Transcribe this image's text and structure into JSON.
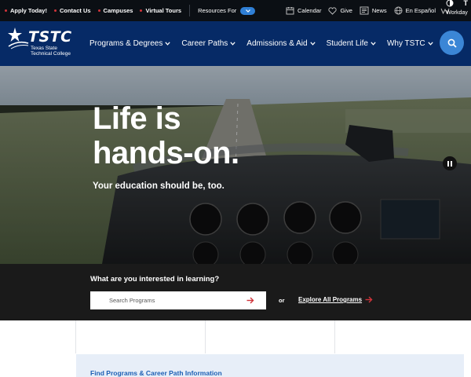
{
  "utility_bar": {
    "links": [
      "Apply Today!",
      "Contact Us",
      "Campuses",
      "Virtual Tours"
    ],
    "resources_label": "Resources For",
    "right": {
      "calendar": "Calendar",
      "give": "Give",
      "news": "News",
      "espanol": "En Español",
      "workday": "Workday"
    }
  },
  "main_nav": {
    "logo_text": "TSTC",
    "logo_sub_line1": "Texas State",
    "logo_sub_line2": "Technical College",
    "items": [
      "Programs & Degrees",
      "Career Paths",
      "Admissions & Aid",
      "Student Life",
      "Why TSTC"
    ]
  },
  "hero": {
    "title_line1": "Life is",
    "title_line2": "hands-on.",
    "subtitle": "Your education should be, too."
  },
  "search_band": {
    "question": "What are you interested in learning?",
    "placeholder": "Search Programs",
    "or": "or",
    "explore": "Explore All Programs"
  },
  "lower": {
    "find_title": "Find Programs & Career Path Information"
  },
  "colors": {
    "nav_bg": "#062a66",
    "accent_blue": "#3b86d6",
    "accent_red": "#d0343a",
    "utility_bg": "#0b0f14",
    "band_bg": "#1a1a1a"
  }
}
